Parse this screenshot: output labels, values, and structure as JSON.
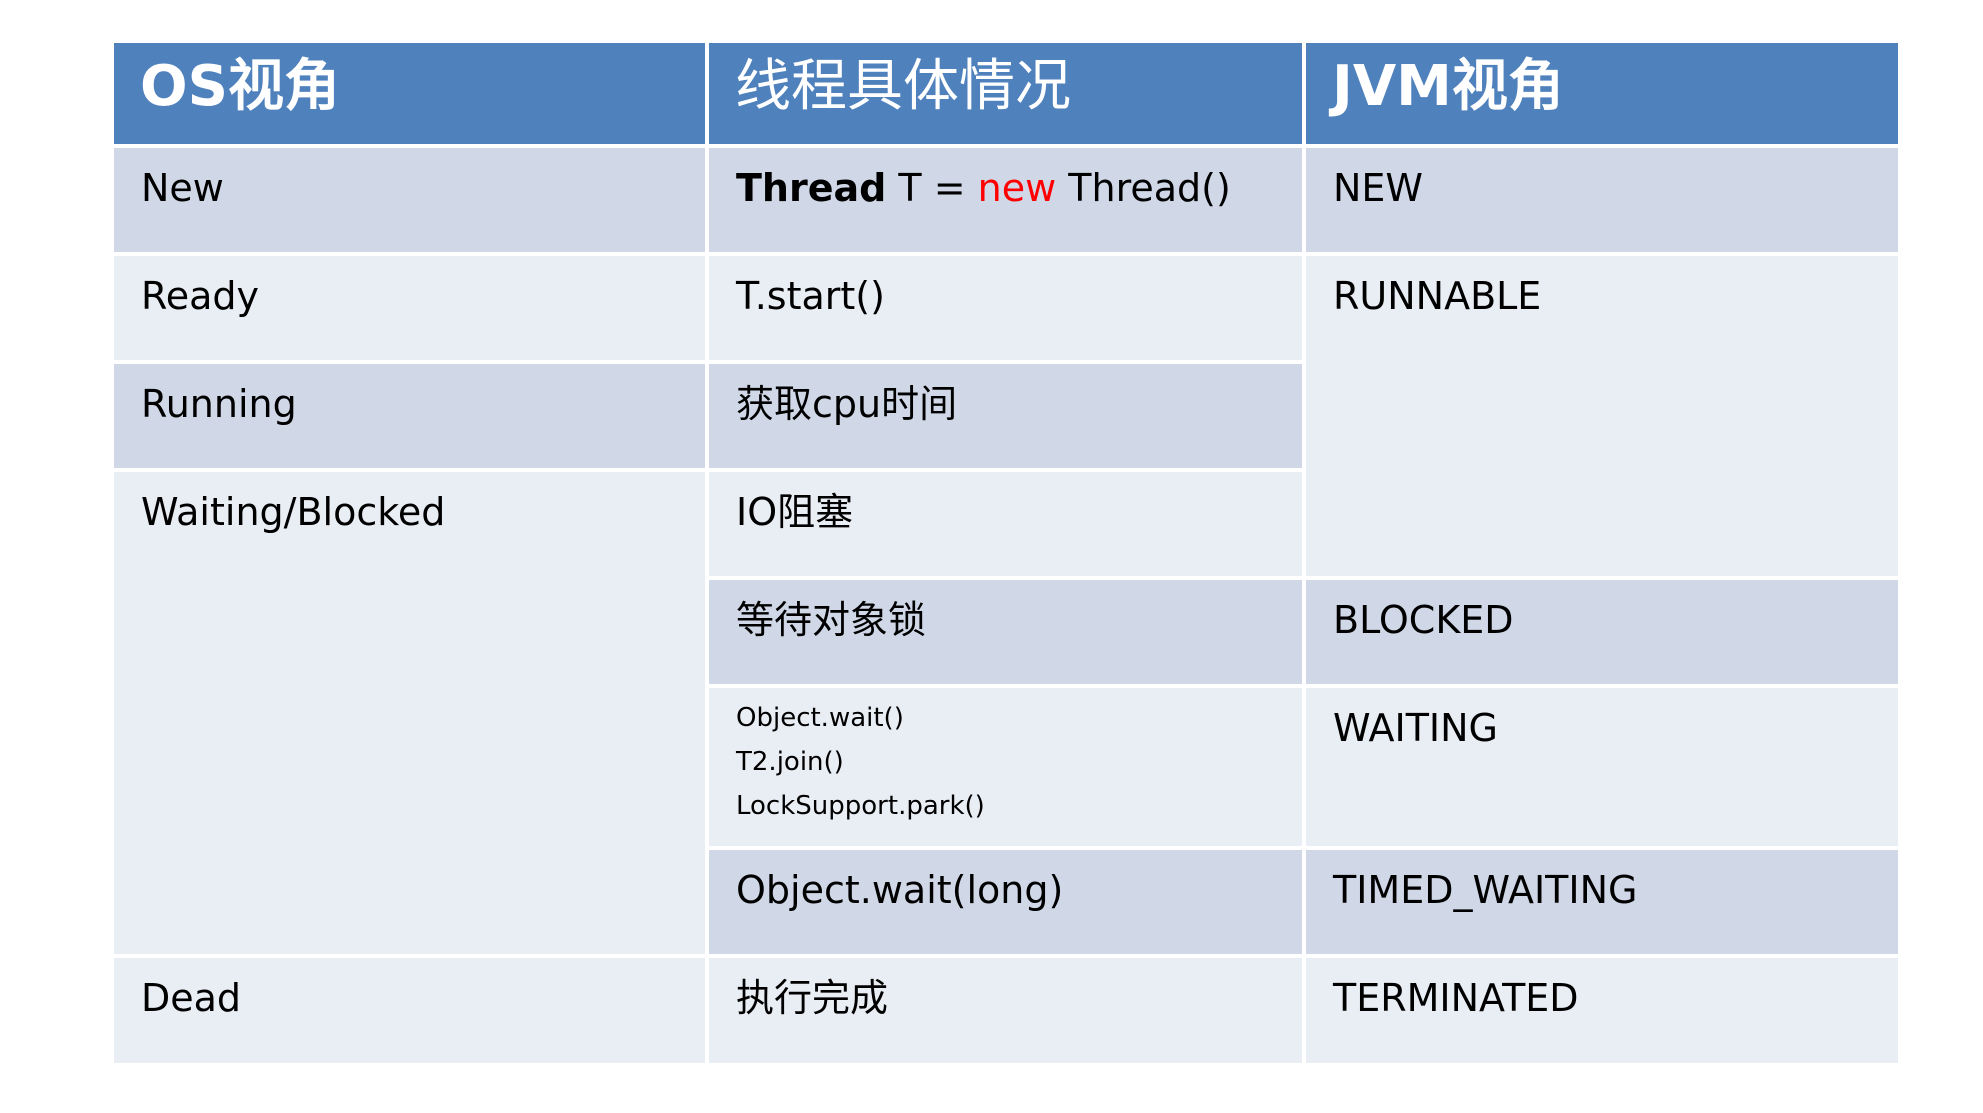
{
  "header": {
    "col1": "OS视角",
    "col2": "线程具体情况",
    "col3": "JVM视角"
  },
  "rows": {
    "new": {
      "os": "New",
      "detail": {
        "part1": "Thread",
        "part2": " T = ",
        "part3": "new",
        "part4": " Thread()"
      },
      "jvm": "NEW"
    },
    "ready": {
      "os": "Ready",
      "detail": "T.start()",
      "jvm": "RUNNABLE"
    },
    "running": {
      "os": "Running",
      "detail": "获取cpu时间"
    },
    "waiting_blocked": {
      "os": "Waiting/Blocked",
      "detail": "IO阻塞"
    },
    "blocked": {
      "detail": "等待对象锁",
      "jvm": "BLOCKED"
    },
    "waiting": {
      "detail_lines": [
        "Object.wait()",
        "T2.join()",
        "LockSupport.park()"
      ],
      "jvm": "WAITING"
    },
    "timed_waiting": {
      "detail": "Object.wait(long)",
      "jvm": "TIMED_WAITING"
    },
    "dead": {
      "os": "Dead",
      "detail": "执行完成",
      "jvm": "TERMINATED"
    }
  },
  "colors": {
    "header_bg": "#4F81BD",
    "row_dark": "#D0D8E8",
    "row_light": "#E9EDF4",
    "keyword_red": "#FF0000"
  }
}
